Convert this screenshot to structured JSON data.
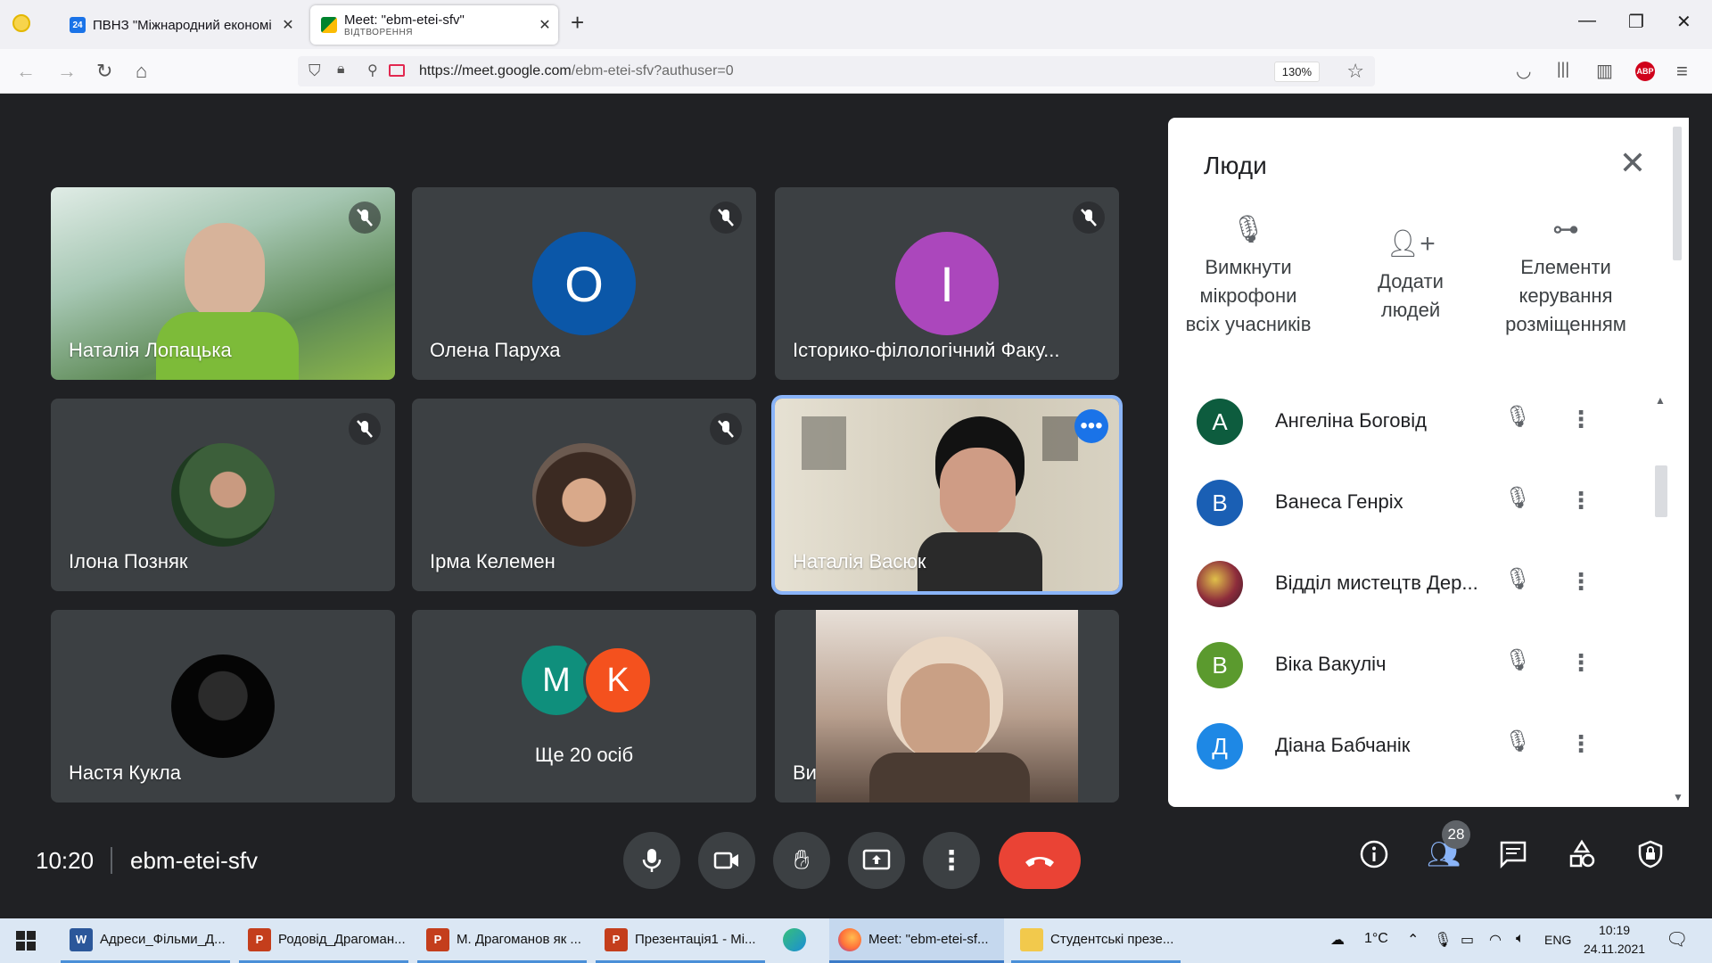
{
  "browser": {
    "tabs": [
      {
        "title": "ПВНЗ \"Міжнародний економі",
        "favicon": "calendar-24-icon",
        "fav_text": "24"
      },
      {
        "title": "Meet: \"ebm-etei-sfv\"",
        "subtitle": "ВІДТВОРЕННЯ",
        "favicon": "meet-icon"
      }
    ],
    "new_tab": "+",
    "url_prefix": "https://meet.google.com",
    "url_path": "/ebm-etei-sfv?authuser=0",
    "zoom": "130%",
    "abp": "ABP"
  },
  "tiles": [
    {
      "name": "Наталія Лопацька",
      "type": "video",
      "muted": true
    },
    {
      "name": "Олена Паруха",
      "type": "avatar",
      "initial": "О",
      "color": "#0b57a8",
      "muted": true
    },
    {
      "name": "Історико-філологічний Факу...",
      "type": "avatar",
      "initial": "І",
      "color": "#ab47bc",
      "muted": true
    },
    {
      "name": "Ілона Позняк",
      "type": "photo",
      "muted": true
    },
    {
      "name": "Ірма Келемен",
      "type": "photo",
      "muted": true
    },
    {
      "name": "Наталія Васюк",
      "type": "video",
      "active": true
    },
    {
      "name": "Настя Кукла",
      "type": "photo"
    },
    {
      "name": "Ще 20 осіб",
      "type": "group",
      "initials": [
        "M",
        "K"
      ],
      "colors": [
        "#0f8f7c",
        "#f4511e"
      ]
    },
    {
      "name": "Ви",
      "type": "video"
    }
  ],
  "people_panel": {
    "title": "Люди",
    "actions": [
      {
        "label_lines": [
          "Вимкнути",
          "мікрофони",
          "всіх учасників"
        ],
        "icon": "mic-off-icon"
      },
      {
        "label_lines": [
          "Додати",
          "людей"
        ],
        "icon": "person-add-icon"
      },
      {
        "label_lines": [
          "Елементи",
          "керування",
          "розміщенням"
        ],
        "icon": "toggle-icon"
      }
    ],
    "people": [
      {
        "name": "Ангеліна Боговід",
        "initial": "А",
        "color": "#0d5c3e"
      },
      {
        "name": "Ванеса Генріх",
        "initial": "В",
        "color": "#1a5fb4"
      },
      {
        "name": "Відділ мистецтв Дер...",
        "initial": "",
        "color": "#8d2c3b"
      },
      {
        "name": "Віка Вакуліч",
        "initial": "В",
        "color": "#5b9a2e"
      },
      {
        "name": "Діана Бабчанік",
        "initial": "Д",
        "color": "#1e88e5"
      }
    ]
  },
  "meeting": {
    "time": "10:20",
    "code": "ebm-etei-sfv",
    "participant_count": "28"
  },
  "taskbar": {
    "items": [
      {
        "label": "Адреси_Фільми_Д...",
        "icon": "word-icon",
        "letter": "W",
        "color": "#2b579a"
      },
      {
        "label": "Родовід_Драгоман...",
        "icon": "powerpoint-icon",
        "letter": "P",
        "color": "#c43e1c"
      },
      {
        "label": "М. Драгоманов як ...",
        "icon": "powerpoint-icon",
        "letter": "P",
        "color": "#c43e1c"
      },
      {
        "label": "Презентація1 - Мі...",
        "icon": "powerpoint-icon",
        "letter": "P",
        "color": "#c43e1c"
      },
      {
        "label": "",
        "icon": "edge-icon",
        "letter": "",
        "color": "#1b8dd6"
      },
      {
        "label": "Meet: \"ebm-etei-sf...",
        "icon": "firefox-icon",
        "letter": "",
        "color": "#ff7139"
      },
      {
        "label": "Студентські презе...",
        "icon": "folder-icon",
        "letter": "",
        "color": "#f2c94c"
      }
    ],
    "temperature": "1°C",
    "lang": "ENG",
    "clock_time": "10:19",
    "clock_date": "24.11.2021"
  }
}
